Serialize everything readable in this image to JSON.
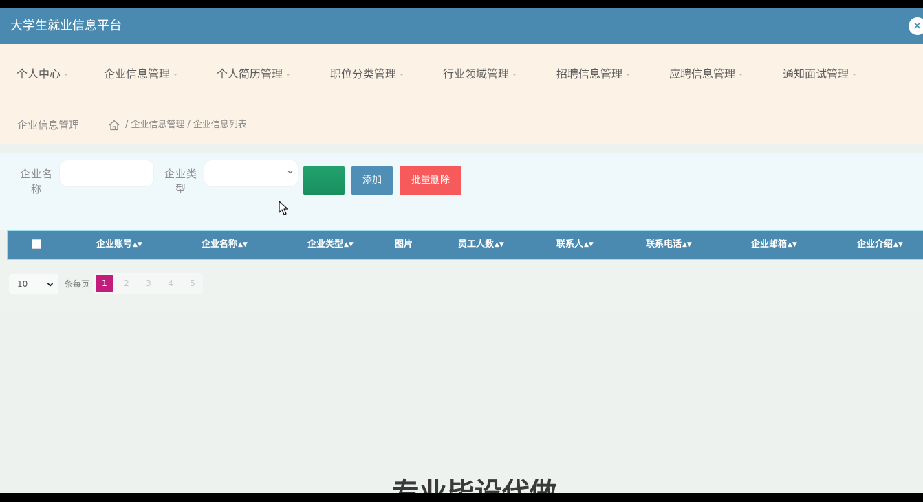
{
  "app": {
    "title": "大学生就业信息平台",
    "close_label": "✕"
  },
  "nav": {
    "items": [
      {
        "label": "个人中心"
      },
      {
        "label": "企业信息管理"
      },
      {
        "label": "个人简历管理"
      },
      {
        "label": "职位分类管理"
      },
      {
        "label": "行业领域管理"
      },
      {
        "label": "招聘信息管理"
      },
      {
        "label": "应聘信息管理"
      },
      {
        "label": "通知面试管理"
      }
    ]
  },
  "breadcrumb": {
    "page_title": "企业信息管理",
    "path": [
      "企业信息管理",
      "企业信息列表"
    ],
    "separator": "/"
  },
  "search": {
    "company_name_label": "企业名称",
    "company_name_value": "",
    "company_type_label": "企业类型",
    "company_type_value": "",
    "search_button": "",
    "add_button": "添加",
    "batch_delete_button": "批量删除"
  },
  "table": {
    "columns": [
      "企业账号",
      "企业名称",
      "企业类型",
      "图片",
      "员工人数",
      "联系人",
      "联系电话",
      "企业邮箱",
      "企业介绍"
    ],
    "sortable": [
      true,
      true,
      true,
      false,
      true,
      true,
      true,
      true,
      true
    ],
    "rows": []
  },
  "pagination": {
    "page_size": "10",
    "per_page_label": "条每页",
    "pages": [
      "1",
      "2",
      "3",
      "4",
      "5"
    ],
    "current_page": 1
  },
  "footer": {
    "partial_text": "专业毕设代做"
  },
  "colors": {
    "header_bg": "#4a8ab0",
    "nav_bg": "#fcf2e6",
    "search_btn": "#1f9a68",
    "add_btn": "#4f8fb5",
    "delete_btn": "#f65a5a",
    "active_page": "#c21c7d"
  },
  "icons": {
    "home": "home-icon",
    "close": "close-icon",
    "sort": "sort-icon",
    "cursor": "mouse-cursor-icon"
  }
}
